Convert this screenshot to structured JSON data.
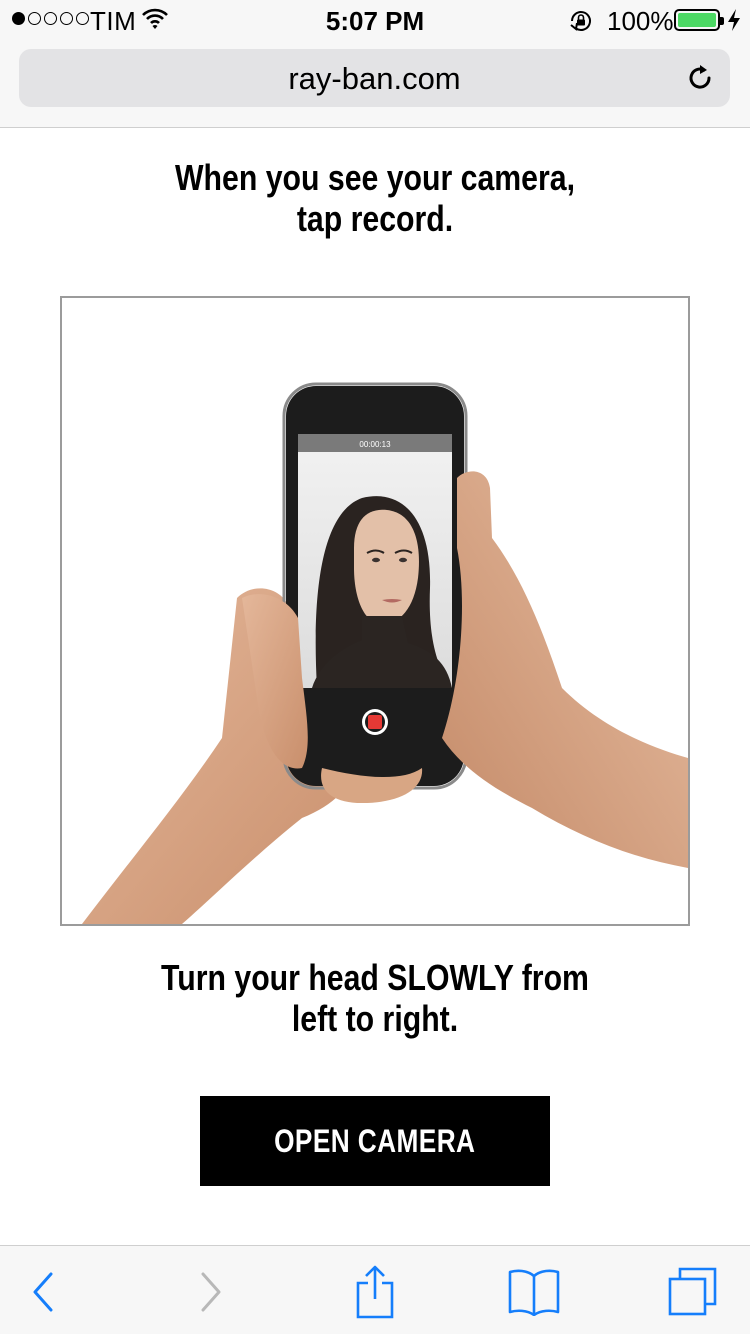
{
  "status_bar": {
    "carrier": "TIM",
    "time": "5:07 PM",
    "battery_percent": "100%",
    "signal_bars_filled": 1,
    "signal_bars_total": 5,
    "icons": [
      "wifi-icon",
      "orientation-lock-icon",
      "battery-icon",
      "charging-bolt-icon"
    ]
  },
  "browser": {
    "url": "ray-ban.com",
    "icons": [
      "reload-icon"
    ]
  },
  "main": {
    "step_instruction_line1": "When you see your camera,",
    "step_instruction_line2": "tap record.",
    "head_instruction_line1": "Turn your head SLOWLY from",
    "head_instruction_line2": "left to right.",
    "open_camera_label": "OPEN CAMERA",
    "illustration_recording_time": "00:00:13"
  },
  "toolbar": {
    "icons": [
      "back-icon",
      "forward-icon",
      "share-icon",
      "bookmarks-icon",
      "tabs-icon"
    ]
  },
  "colors": {
    "accent": "#157efb",
    "disabled": "#b8b8b8",
    "battery": "#4cd964",
    "button_bg": "#000000",
    "record": "#e53935"
  }
}
